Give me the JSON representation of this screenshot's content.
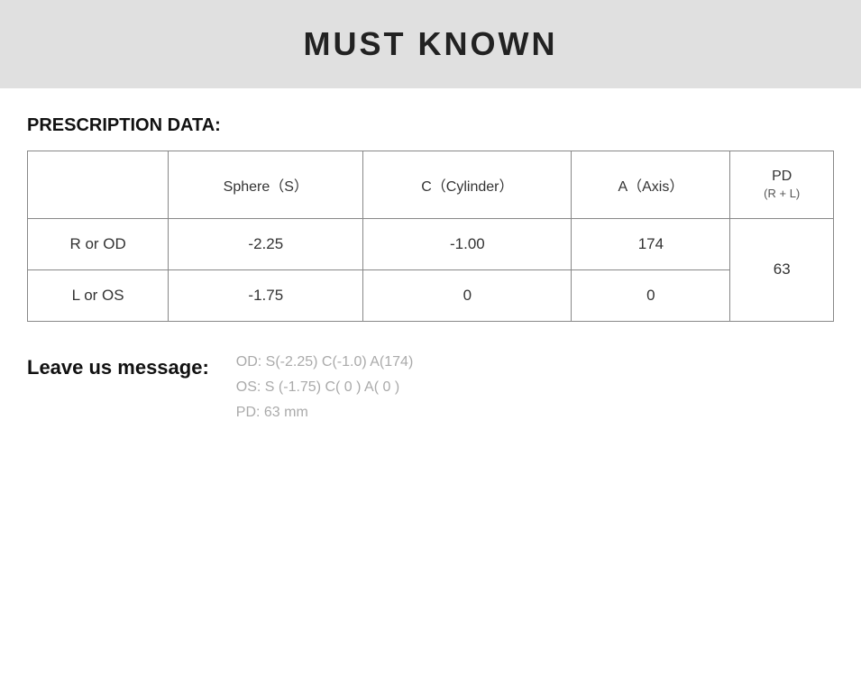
{
  "header": {
    "title": "MUST KNOWN"
  },
  "section": {
    "prescription_label": "PRESCRIPTION DATA:"
  },
  "table": {
    "columns": [
      {
        "label": "",
        "sublabel": ""
      },
      {
        "label": "Sphere（S）",
        "sublabel": ""
      },
      {
        "label": "C（Cylinder）",
        "sublabel": ""
      },
      {
        "label": "A（Axis）",
        "sublabel": ""
      },
      {
        "label": "PD",
        "sublabel": "(R + L)"
      }
    ],
    "rows": [
      {
        "label": "R or OD",
        "sphere": "-2.25",
        "cylinder": "-1.00",
        "axis": "174",
        "pd": "63"
      },
      {
        "label": "L or OS",
        "sphere": "-1.75",
        "cylinder": "0",
        "axis": "0",
        "pd": ""
      }
    ]
  },
  "leave_message": {
    "label": "Leave us message:",
    "lines": [
      "OD:  S(-2.25)    C(-1.0)   A(174)",
      "OS:  S (-1.75)    C( 0 )     A( 0 )",
      "PD:  63 mm"
    ]
  }
}
